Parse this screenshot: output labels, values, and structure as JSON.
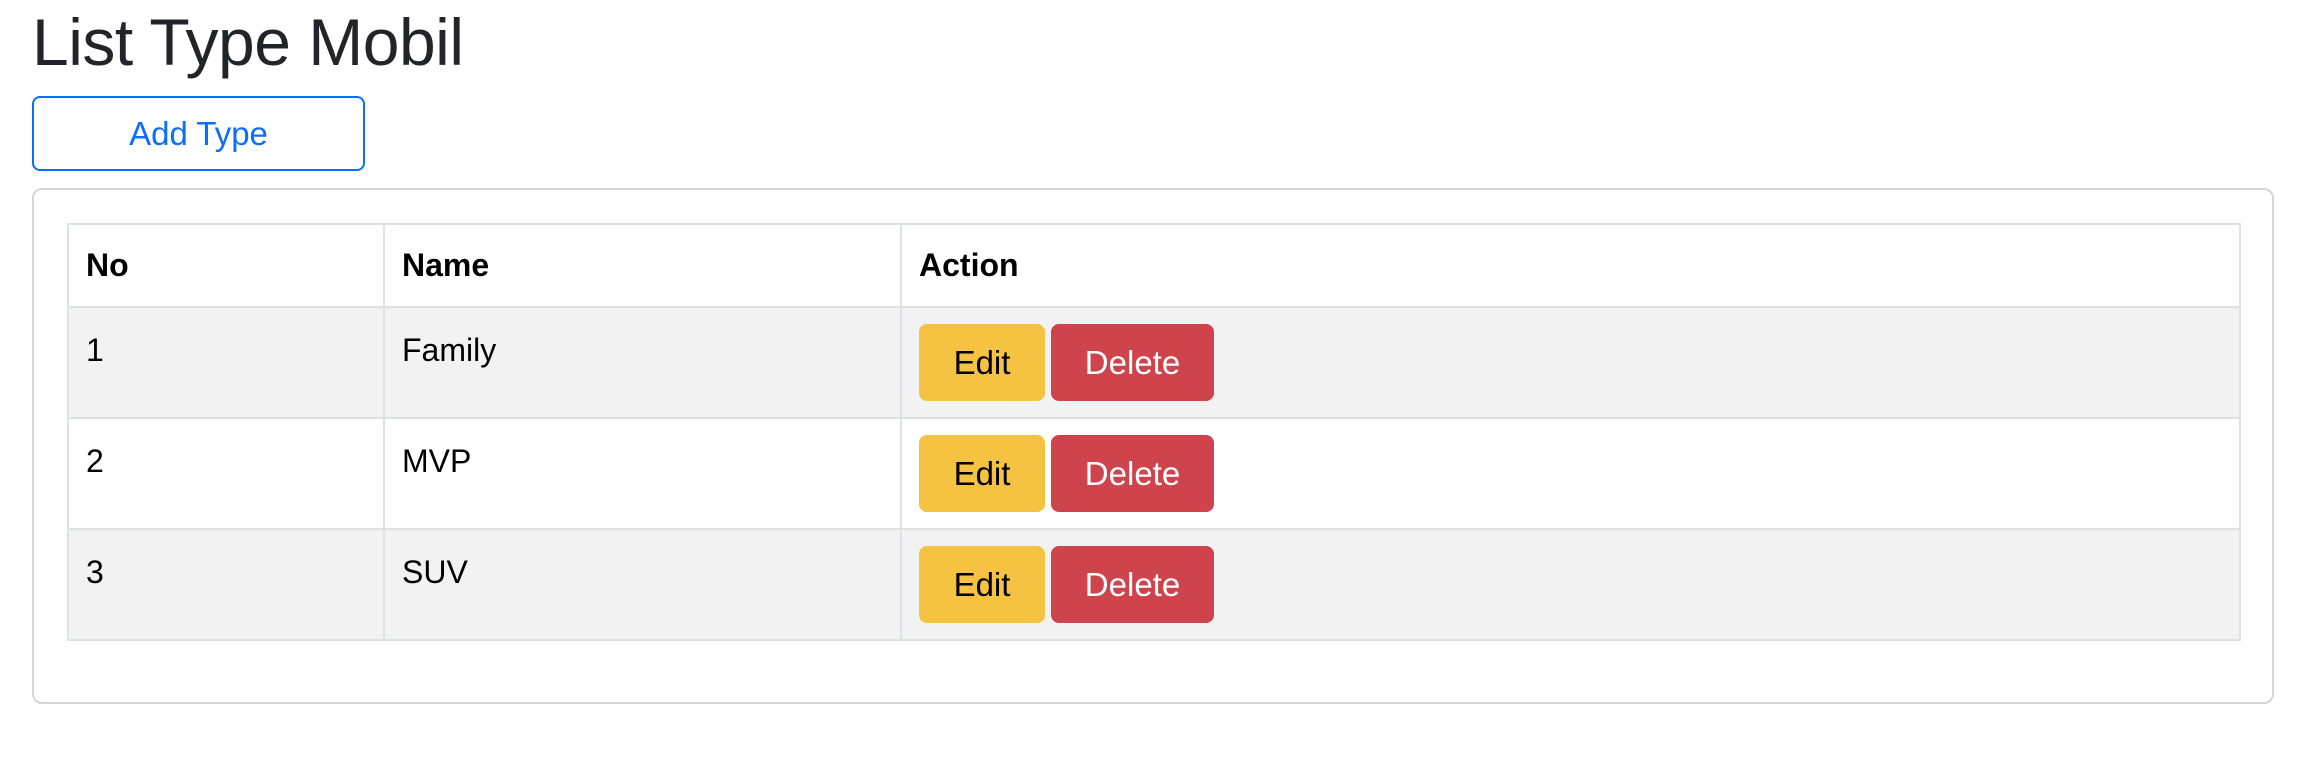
{
  "page": {
    "title": "List Type Mobil"
  },
  "toolbar": {
    "add_label": "Add Type"
  },
  "table": {
    "columns": [
      "No",
      "Name",
      "Action"
    ],
    "rows": [
      {
        "no": "1",
        "name": "Family",
        "edit_label": "Edit",
        "delete_label": "Delete"
      },
      {
        "no": "2",
        "name": "MVP",
        "edit_label": "Edit",
        "delete_label": "Delete"
      },
      {
        "no": "3",
        "name": "SUV",
        "edit_label": "Edit",
        "delete_label": "Delete"
      }
    ]
  },
  "colors": {
    "primary": "#0d6efd",
    "edit_button": "#f5c242",
    "delete_button": "#cf434c",
    "striped_row": "#f2f2f2"
  }
}
